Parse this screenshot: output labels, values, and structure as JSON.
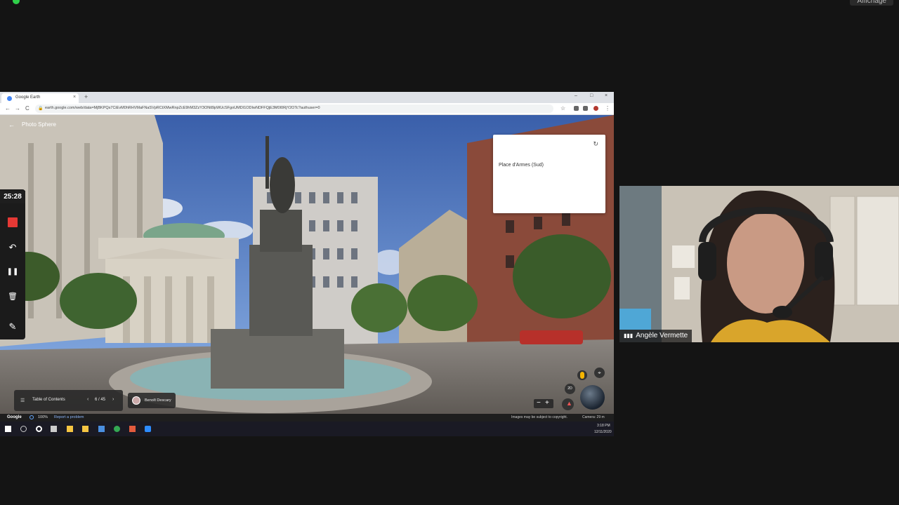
{
  "top": {
    "view_label": "Affichage"
  },
  "browser": {
    "tab_title": "Google Earth",
    "tab_close": "×",
    "new_tab": "+",
    "window_controls": [
      "–",
      "□",
      "×"
    ],
    "nav": [
      "←",
      "→",
      "C"
    ],
    "url": "earth.google.com/web/data=MjBKPQs7CiEvM0hRHVMaFNaSVpRCtXMwRnpZcE9hM3ZzY3ONtl9pWUcSFgoUMDI1ODIwNDFFQjE3M0I0RjY2OTc?authuser=0"
  },
  "earth": {
    "photo_sphere_title": "Photo Sphere",
    "back_icon": "←",
    "info_card_title": "Place d'Armes (Sud)",
    "refresh_icon": "↻",
    "toc_label": "Table of Contents",
    "toc_page": "6 / 45",
    "toc_prev": "‹",
    "toc_next": "›",
    "author_name": "Benoît Descary",
    "zoom_minus": "−",
    "zoom_plus": "+",
    "two_d_label": "2D",
    "recenter_icon": "⌖"
  },
  "statusbar": {
    "google": "Google",
    "zoom": "100%",
    "report": "Report a problem",
    "copyright": "Images may be subject to copyright.",
    "camera": "Camera: 29 m"
  },
  "taskbar": {
    "time": "3:18 PM",
    "date": "12/11/2020",
    "icon_colors": [
      "#ffffff",
      "#cccccc",
      "#ffffff",
      "#cccccc",
      "#f5c542",
      "#f5c542",
      "#4a8fe0",
      "#34a853",
      "#e25b3d",
      "#2d8cff"
    ]
  },
  "annotation": {
    "timer": "25:28",
    "undo_icon": "↶",
    "pause_icon": "❚❚",
    "delete_icon": "🗑",
    "pen_icon": "✎"
  },
  "participant": {
    "name": "Angèle Vermette",
    "signal_icon": "▮▮▮"
  },
  "colors": {
    "record": "#e53935",
    "background": "#141414",
    "link": "#8ab4f8"
  }
}
